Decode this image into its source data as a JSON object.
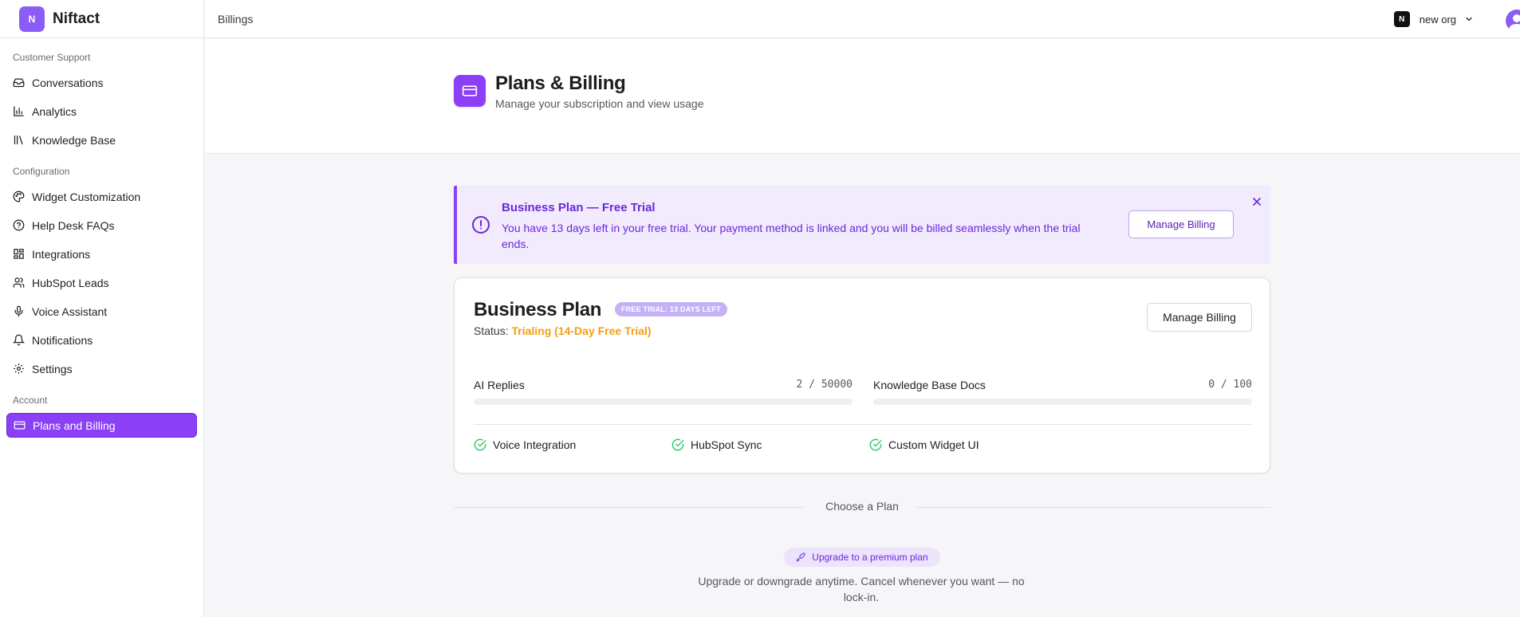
{
  "app": {
    "logo_text": "N",
    "name": "Niftact"
  },
  "topbar": {
    "title": "Billings",
    "org_icon_text": "N",
    "org_name": "new org"
  },
  "sidebar": {
    "sections": [
      {
        "label": "Customer Support",
        "items": [
          {
            "label": "Conversations",
            "icon": "inbox-icon"
          },
          {
            "label": "Analytics",
            "icon": "bar-chart-icon"
          },
          {
            "label": "Knowledge Base",
            "icon": "library-icon"
          }
        ]
      },
      {
        "label": "Configuration",
        "items": [
          {
            "label": "Widget Customization",
            "icon": "palette-icon"
          },
          {
            "label": "Help Desk FAQs",
            "icon": "help-circle-icon"
          },
          {
            "label": "Integrations",
            "icon": "grid-icon"
          },
          {
            "label": "HubSpot Leads",
            "icon": "users-icon"
          },
          {
            "label": "Voice Assistant",
            "icon": "mic-icon"
          },
          {
            "label": "Notifications",
            "icon": "bell-icon"
          },
          {
            "label": "Settings",
            "icon": "gear-icon"
          }
        ]
      },
      {
        "label": "Account",
        "items": [
          {
            "label": "Plans and Billing",
            "icon": "credit-card-icon",
            "active": true
          }
        ]
      }
    ]
  },
  "header": {
    "title": "Plans & Billing",
    "subtitle": "Manage your subscription and view usage"
  },
  "banner": {
    "title": "Business Plan — Free Trial",
    "text": "You have 13 days left in your free trial. Your payment method is linked and you will be billed seamlessly when the trial ends.",
    "button": "Manage Billing"
  },
  "plan": {
    "name": "Business Plan",
    "badge": "FREE TRIAL: 13 DAYS LEFT",
    "status_label": "Status:",
    "status_value": "Trialing (14-Day Free Trial)",
    "button": "Manage Billing",
    "usage": [
      {
        "label": "AI Replies",
        "count": "2 / 50000",
        "used": 2,
        "limit": 50000
      },
      {
        "label": "Knowledge Base Docs",
        "count": "0 / 100",
        "used": 0,
        "limit": 100
      }
    ],
    "features": [
      "Voice Integration",
      "HubSpot Sync",
      "Custom Widget UI"
    ]
  },
  "choose": {
    "label": "Choose a Plan",
    "pill": "Upgrade to a premium plan",
    "text": "Upgrade or downgrade anytime. Cancel whenever you want — no lock-in."
  },
  "colors": {
    "accent": "#8b3ff6",
    "status": "#f59e0b",
    "success": "#22c55e"
  }
}
